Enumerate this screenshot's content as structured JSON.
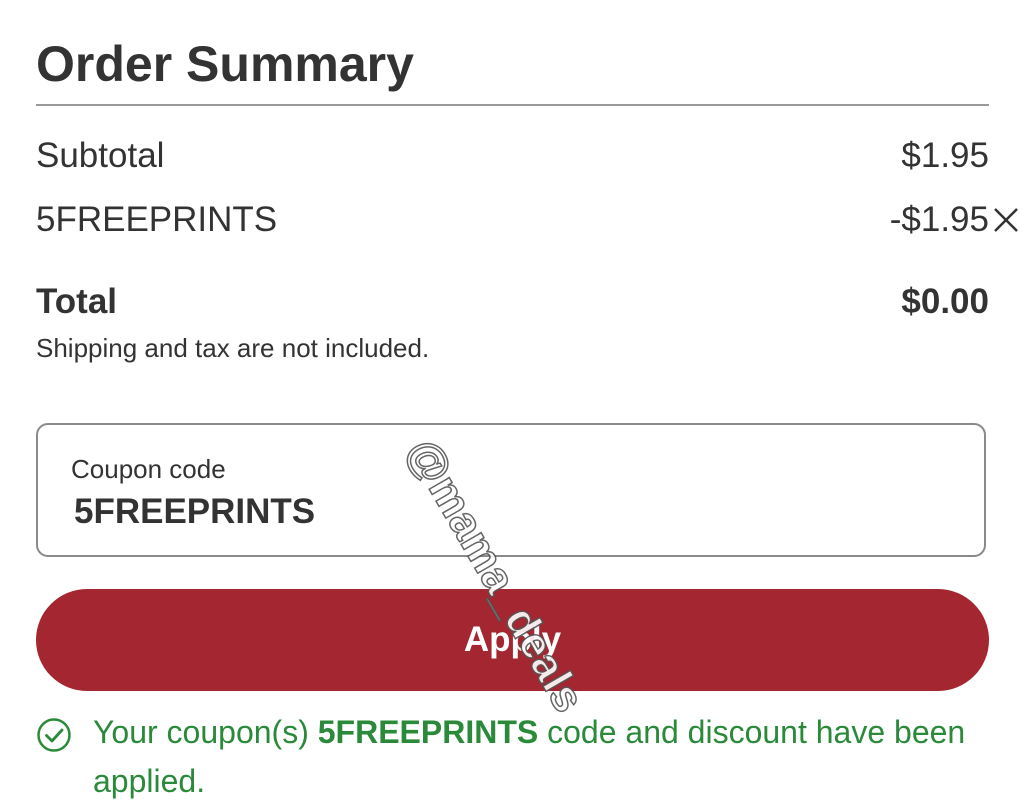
{
  "order_summary": {
    "title": "Order Summary",
    "subtotal_label": "Subtotal",
    "subtotal_value": "$1.95",
    "discount_label": "5FREEPRINTS",
    "discount_value": "-$1.95",
    "remove_icon": "close-icon",
    "total_label": "Total",
    "total_value": "$0.00",
    "note": "Shipping and tax are not included."
  },
  "coupon": {
    "label": "Coupon code",
    "value": "5FREEPRINTS"
  },
  "apply_button": {
    "label": "Apply",
    "color": "#a32631"
  },
  "success_message": {
    "icon": "check-circle-icon",
    "prefix": "Your coupon(s) ",
    "code": "5FREEPRINTS",
    "suffix": " code and discount have been applied.",
    "color": "#2a8a3a"
  },
  "watermark": {
    "text": "@mama_deals"
  }
}
